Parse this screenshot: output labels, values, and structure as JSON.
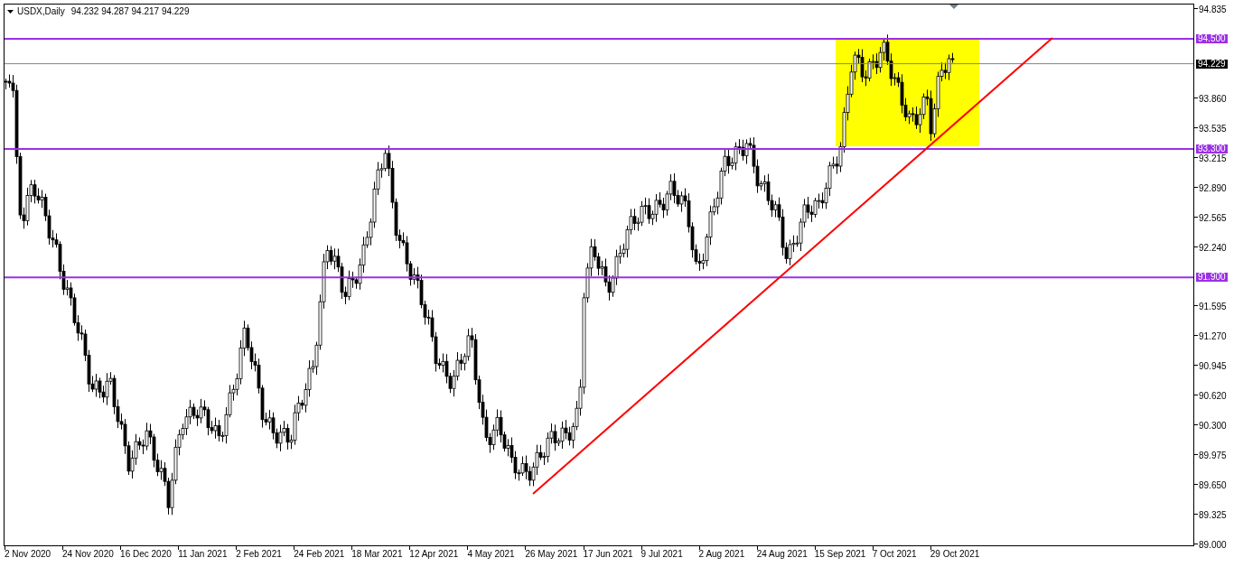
{
  "header": {
    "symbol": "USDX,Daily",
    "ohlc": "94.232 94.287 94.217 94.229"
  },
  "price_axis": [
    "94.835",
    "93.860",
    "93.535",
    "93.215",
    "92.890",
    "92.565",
    "92.240",
    "91.595",
    "91.270",
    "90.945",
    "90.620",
    "90.300",
    "89.975",
    "89.650",
    "89.325",
    "89.000"
  ],
  "levels": [
    {
      "label": "94.500"
    },
    {
      "label": "93.300"
    },
    {
      "label": "91.900"
    }
  ],
  "current_price": {
    "label": "94.229"
  },
  "time_axis": [
    "2 Nov 2020",
    "24 Nov 2020",
    "16 Dec 2020",
    "11 Jan 2021",
    "2 Feb 2021",
    "24 Feb 2021",
    "18 Mar 2021",
    "12 Apr 2021",
    "4 May 2021",
    "26 May 2021",
    "17 Jun 2021",
    "9 Jul 2021",
    "2 Aug 2021",
    "24 Aug 2021",
    "15 Sep 2021",
    "7 Oct 2021",
    "29 Oct 2021"
  ]
}
